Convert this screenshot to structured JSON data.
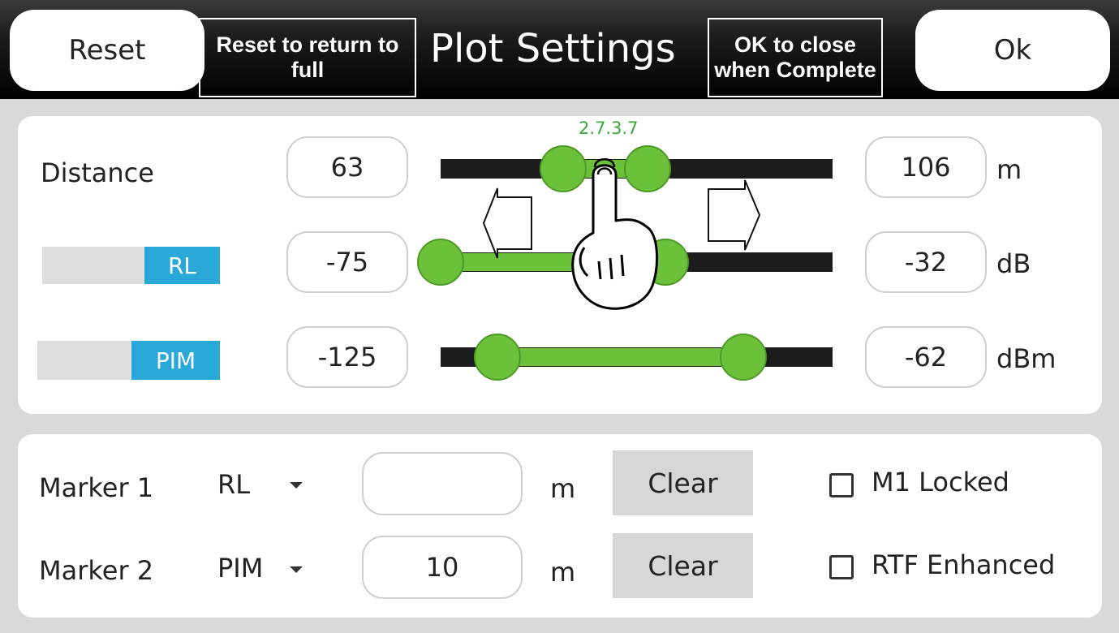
{
  "header": {
    "reset_label": "Reset",
    "reset_note": "Reset to return to full",
    "title": "Plot Settings",
    "ok_note": "OK to close when Complete",
    "ok_label": "Ok"
  },
  "ranges": {
    "tooltip": "2.7.3.7",
    "rows": [
      {
        "label": "Distance",
        "min": "63",
        "max": "106",
        "unit": "m"
      },
      {
        "toggle": "RL",
        "min": "-75",
        "max": "-32",
        "unit": "dB"
      },
      {
        "toggle": "PIM",
        "min": "-125",
        "max": "-62",
        "unit": "dBm"
      }
    ]
  },
  "markers": {
    "rows": [
      {
        "label": "Marker 1",
        "type": "RL",
        "value": "",
        "unit": "m",
        "clear": "Clear",
        "check_label": "M1 Locked"
      },
      {
        "label": "Marker 2",
        "type": "PIM",
        "value": "10",
        "unit": "m",
        "clear": "Clear",
        "check_label": "RTF Enhanced"
      }
    ]
  },
  "icons": [
    "hand-pointer-icon",
    "arrow-left-icon",
    "arrow-right-icon",
    "chevron-down-icon"
  ],
  "colors": {
    "accent": "#6bc23a",
    "toggle_on": "#2aa8d8",
    "tooltip": "#3aa83a"
  }
}
